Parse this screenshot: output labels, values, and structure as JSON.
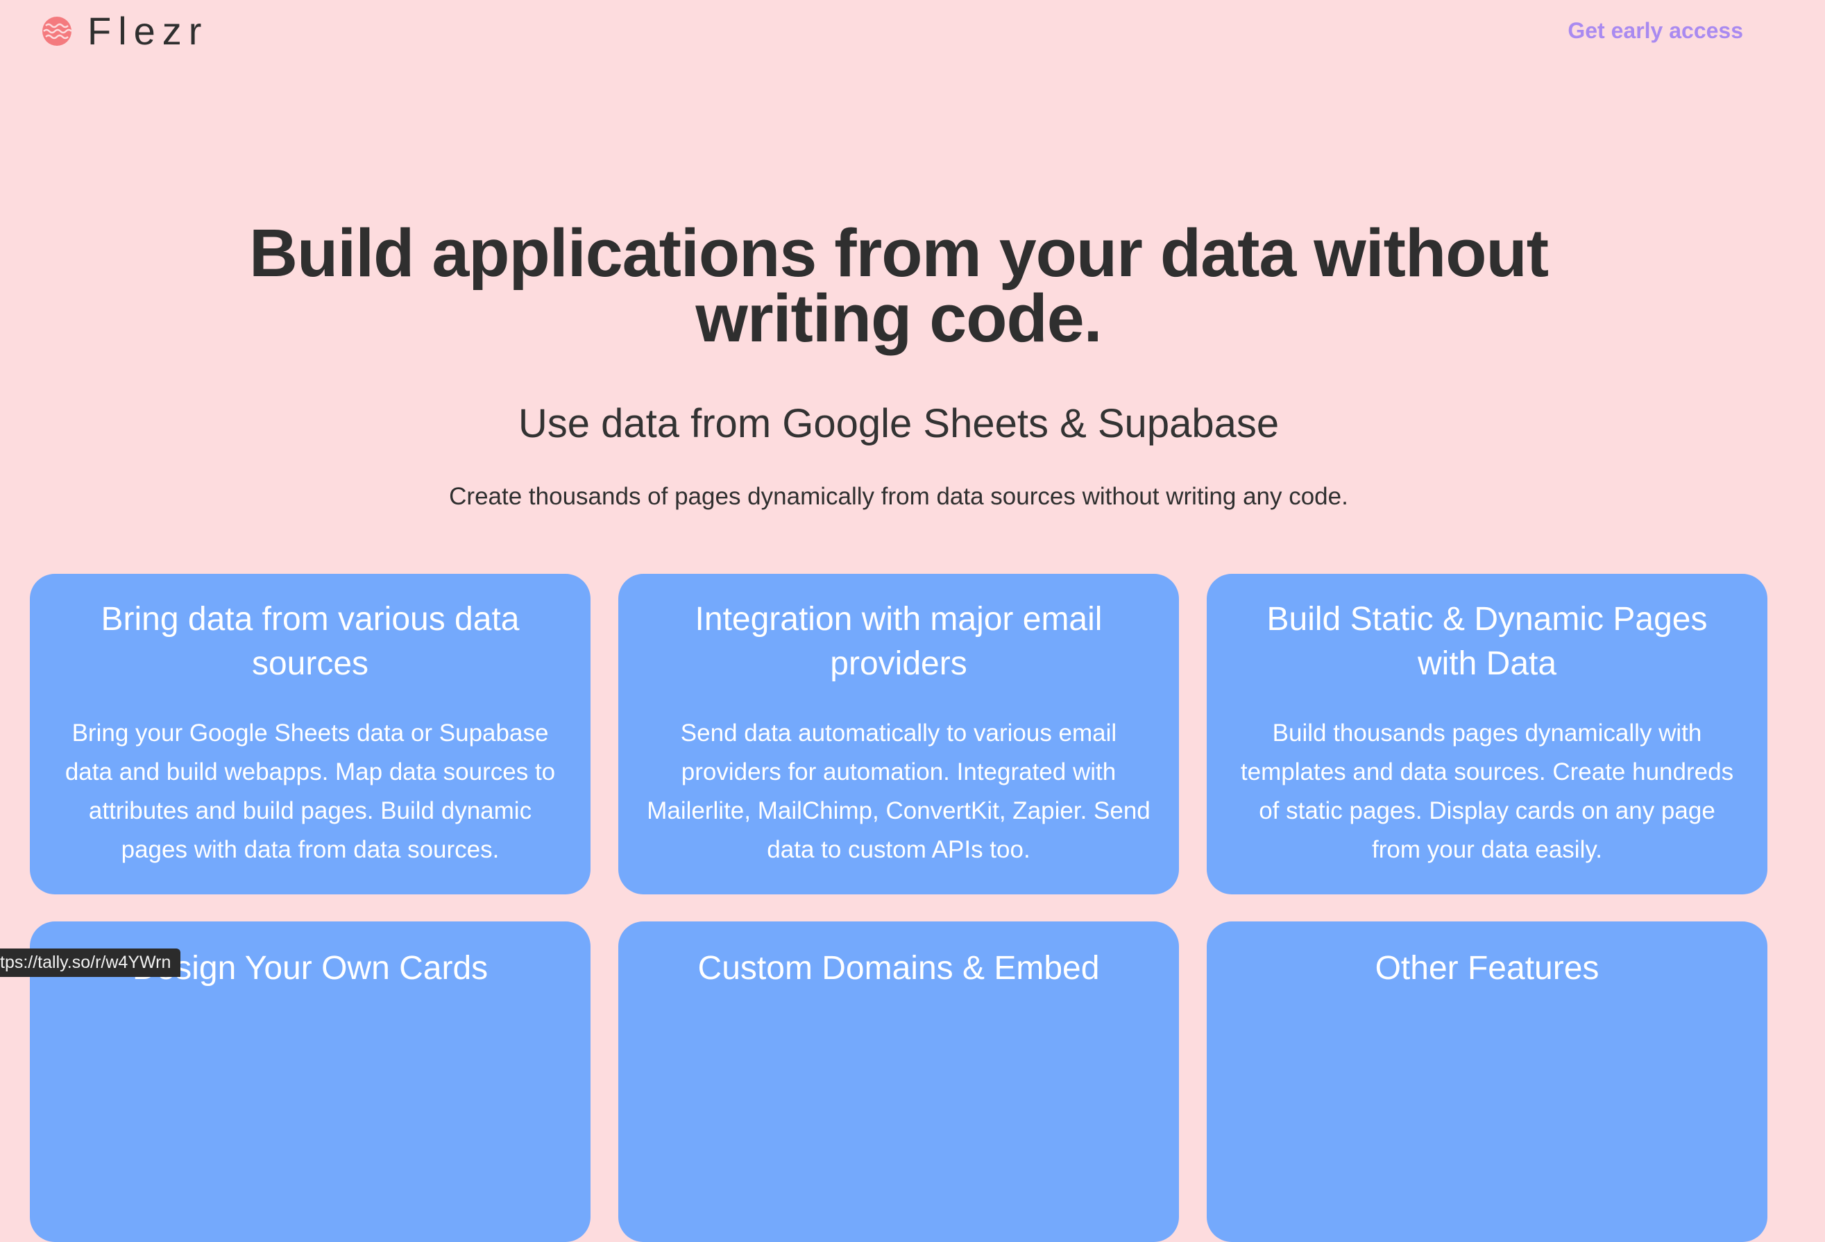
{
  "header": {
    "brand": "Flezr",
    "logo_icon": "flezr-logo-icon",
    "cta_label": "Get early access",
    "cta_color": "#a98af0"
  },
  "hero": {
    "title": "Build applications from your data without writing code.",
    "subtitle": "Use data from Google Sheets & Supabase",
    "description": "Create thousands of pages dynamically from data sources without writing any code."
  },
  "features": [
    {
      "title": "Bring data from various data sources",
      "body": "Bring your Google Sheets data or Supabase data and build webapps. Map data sources to attributes and build pages. Build dynamic pages with data from data sources."
    },
    {
      "title": "Integration with major email providers",
      "body": "Send data automatically to various email providers for automation. Integrated with Mailerlite, MailChimp, ConvertKit, Zapier. Send data to custom APIs too."
    },
    {
      "title": "Build Static & Dynamic Pages with Data",
      "body": "Build thousands pages dynamically with templates and data sources. Create hundreds of static pages. Display cards on any page from your data easily."
    },
    {
      "title": "Design Your Own Cards"
    },
    {
      "title": "Custom Domains & Embed"
    },
    {
      "title": "Other Features"
    }
  ],
  "status_bar": {
    "url": "tps://tally.so/r/w4YWrn"
  },
  "colors": {
    "background": "#fddcde",
    "card": "#74a9fc",
    "text": "#2f2f2f",
    "logo": "#f47a7e"
  }
}
